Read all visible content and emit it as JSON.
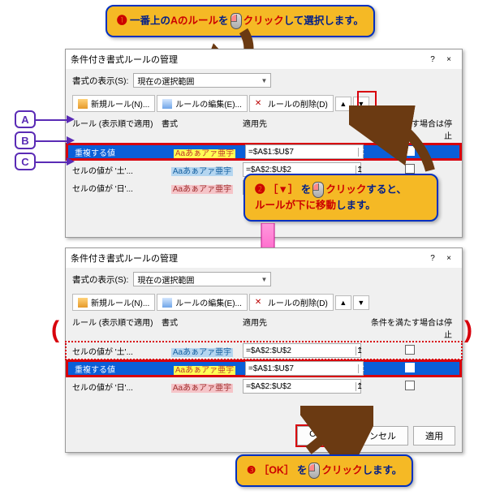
{
  "dialog": {
    "title": "条件付き書式ルールの管理",
    "help": "?",
    "close": "×",
    "display_label": "書式の表示(S):",
    "display_value": "現在の選択範囲",
    "new_rule": "新規ルール(N)...",
    "edit_rule": "ルールの編集(E)...",
    "delete_rule": "ルールの削除(D)",
    "hdr_rule": "ルール (表示順で適用)",
    "hdr_format": "書式",
    "hdr_applies": "適用先",
    "hdr_stop": "条件を満たす場合は停止",
    "ok": "OK",
    "cancel": "キャンセル",
    "apply": "適用"
  },
  "rules": {
    "A": {
      "name": "重複する値",
      "sample": "Aaあぁアァ亜宇",
      "range": "=$A$1:$U$7"
    },
    "B": {
      "name": "セルの値が '土'...",
      "sample": "Aaあぁアァ亜宇",
      "range": "=$A$2:$U$2"
    },
    "C": {
      "name": "セルの値が '日'...",
      "sample": "Aaあぁアァ亜宇",
      "range": "=$A$2:$U$2"
    }
  },
  "markers": {
    "A": "A",
    "B": "B",
    "C": "C"
  },
  "callouts": {
    "c1a": "❶",
    "c1_pre": "一番上の",
    "c1_A": "Aのルール",
    "c1_mid": "を",
    "c1_click": "クリック",
    "c1_end": "して選択します。",
    "c2a": "❷",
    "c2_pre": "［▼］",
    "c2_mid": "を",
    "c2_click": "クリック",
    "c2_end": "すると、",
    "c2_line2a": "ルールが下に移動",
    "c2_line2b": "します。",
    "c3a": "❸",
    "c3_pre": "［OK］",
    "c3_mid": "を",
    "c3_click": "クリック",
    "c3_end": "します。"
  },
  "arrows": {
    "up": "▲",
    "down": "▼",
    "pick": "↥"
  }
}
